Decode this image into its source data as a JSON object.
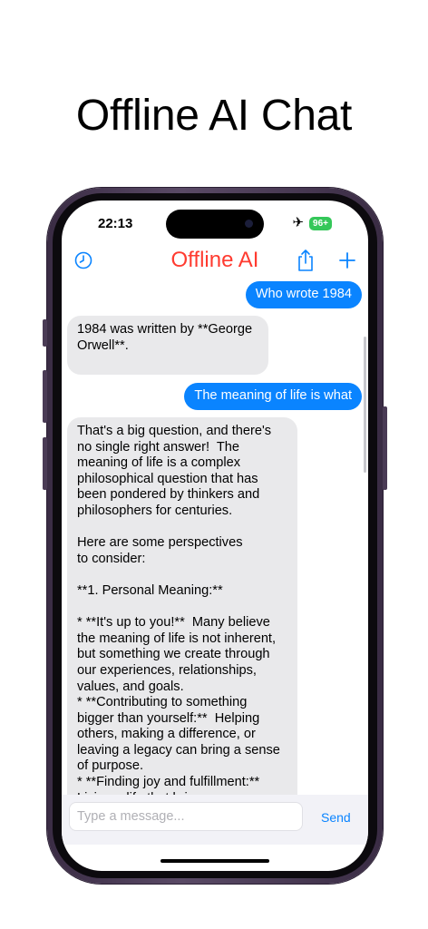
{
  "headline": "Offline AI Chat",
  "status": {
    "time": "22:13",
    "battery": "96+"
  },
  "nav": {
    "title": "Offline AI"
  },
  "messages": [
    {
      "role": "user",
      "text": "Who wrote 1984"
    },
    {
      "role": "ai",
      "text": "1984 was written by **George\nOrwell**."
    },
    {
      "role": "user",
      "text": "The meaning of life is what"
    },
    {
      "role": "ai",
      "text": "That's a big question, and there's\nno single right answer!  The\nmeaning of life is a complex\nphilosophical question that has\nbeen pondered by thinkers and\nphilosophers for centuries.\n\nHere are some perspectives\nto consider:\n\n**1. Personal Meaning:**\n\n* **It's up to you!**  Many believe\nthe meaning of life is not inherent,\nbut something we create through\nour experiences, relationships,\nvalues, and goals.\n* **Contributing to something\nbigger than yourself:**  Helping\nothers, making a difference, or\nleaving a legacy can bring a sense\nof purpose.\n* **Finding joy and fulfillment:**\nLiving a life that brings you"
    }
  ],
  "composer": {
    "placeholder": "Type a message...",
    "value": "",
    "send_label": "Send"
  },
  "colors": {
    "accent": "#0a84ff",
    "title": "#ff3b30",
    "ai_bubble": "#e9e9eb",
    "battery": "#34c759"
  }
}
